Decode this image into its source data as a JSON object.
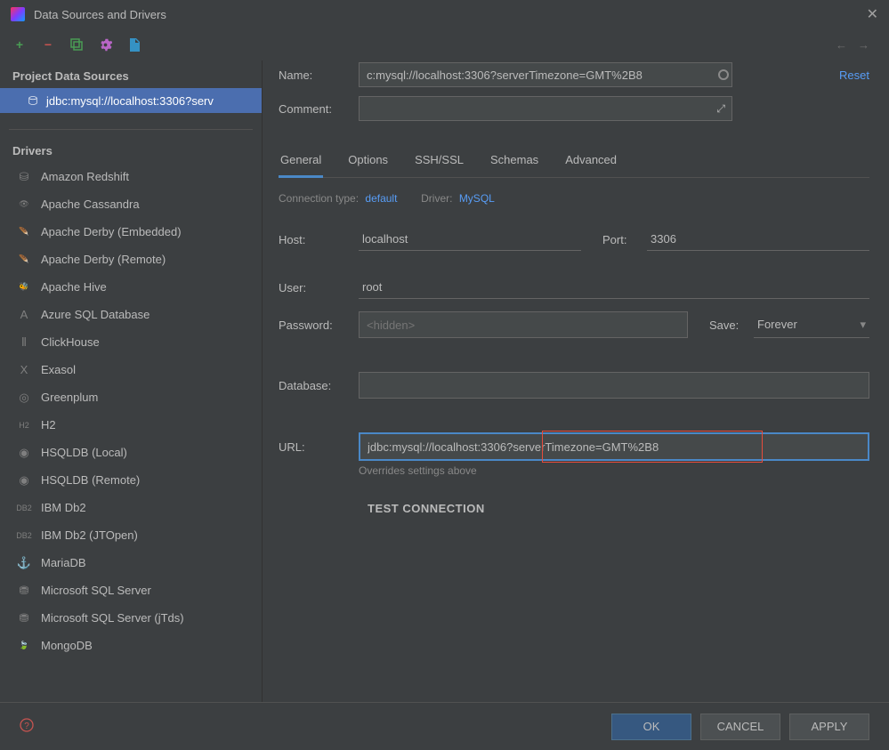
{
  "window": {
    "title": "Data Sources and Drivers"
  },
  "sidebar": {
    "project_header": "Project Data Sources",
    "selected_ds": "jdbc:mysql://localhost:3306?serv",
    "drivers_header": "Drivers",
    "drivers": [
      {
        "name": "Amazon Redshift",
        "icon": "⛁"
      },
      {
        "name": "Apache Cassandra",
        "icon": "👁"
      },
      {
        "name": "Apache Derby (Embedded)",
        "icon": "🪶"
      },
      {
        "name": "Apache Derby (Remote)",
        "icon": "🪶"
      },
      {
        "name": "Apache Hive",
        "icon": "🐝"
      },
      {
        "name": "Azure SQL Database",
        "icon": "A"
      },
      {
        "name": "ClickHouse",
        "icon": "⦀"
      },
      {
        "name": "Exasol",
        "icon": "X"
      },
      {
        "name": "Greenplum",
        "icon": "◎"
      },
      {
        "name": "H2",
        "icon": "H2"
      },
      {
        "name": "HSQLDB (Local)",
        "icon": "◉"
      },
      {
        "name": "HSQLDB (Remote)",
        "icon": "◉"
      },
      {
        "name": "IBM Db2",
        "icon": "DB2"
      },
      {
        "name": "IBM Db2 (JTOpen)",
        "icon": "DB2"
      },
      {
        "name": "MariaDB",
        "icon": "⚓"
      },
      {
        "name": "Microsoft SQL Server",
        "icon": "⛃"
      },
      {
        "name": "Microsoft SQL Server (jTds)",
        "icon": "⛃"
      },
      {
        "name": "MongoDB",
        "icon": "🍃"
      }
    ]
  },
  "form": {
    "name_label": "Name:",
    "name_value": "c:mysql://localhost:3306?serverTimezone=GMT%2B8",
    "reset": "Reset",
    "comment_label": "Comment:",
    "comment_value": "",
    "tabs": [
      "General",
      "Options",
      "SSH/SSL",
      "Schemas",
      "Advanced"
    ],
    "conn_type_label": "Connection type:",
    "conn_type_value": "default",
    "driver_label": "Driver:",
    "driver_value": "MySQL",
    "host_label": "Host:",
    "host_value": "localhost",
    "port_label": "Port:",
    "port_value": "3306",
    "user_label": "User:",
    "user_value": "root",
    "password_label": "Password:",
    "password_placeholder": "<hidden>",
    "save_label": "Save:",
    "save_value": "Forever",
    "database_label": "Database:",
    "database_value": "",
    "url_label": "URL:",
    "url_value": "jdbc:mysql://localhost:3306?serverTimezone=GMT%2B8",
    "override_note": "Overrides settings above",
    "test_connection": "TEST CONNECTION"
  },
  "footer": {
    "ok": "OK",
    "cancel": "CANCEL",
    "apply": "APPLY"
  }
}
